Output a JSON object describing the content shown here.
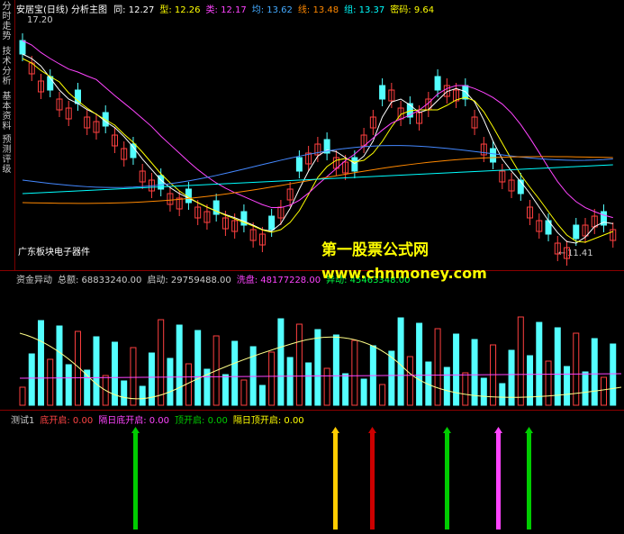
{
  "side_tabs": [
    {
      "id": "tab-timeshare",
      "label": "分时走势"
    },
    {
      "id": "tab-technical",
      "label": "技术分析"
    },
    {
      "id": "tab-fundamental",
      "label": "基本资料"
    },
    {
      "id": "tab-forecast",
      "label": "预测评级"
    }
  ],
  "header": {
    "title": "安居宝(日线) 分析主图",
    "items": [
      {
        "label": "同: 12.27",
        "color": "#ffffff"
      },
      {
        "label": "型: 12.26",
        "color": "#ffff00"
      },
      {
        "label": "类: 12.17",
        "color": "#ff44ff"
      },
      {
        "label": "均: 13.62",
        "color": "#44aaff"
      },
      {
        "label": "线: 13.48",
        "color": "#ff8800"
      },
      {
        "label": "组: 13.37",
        "color": "#00ffff"
      },
      {
        "label": "密码: 9.64",
        "color": "#ffff00"
      }
    ]
  },
  "price": {
    "high_label": "17.20",
    "low_label": "11.41",
    "sector": "广东板块",
    "industry": "电子器件"
  },
  "watermark": {
    "line1": "第一股票公式网",
    "line2": "www.chnmoney.com"
  },
  "fund_panel": {
    "items": [
      {
        "label": "资金异动",
        "color": "#cccccc"
      },
      {
        "label": "总额: 68833240.00",
        "color": "#cccccc"
      },
      {
        "label": "启动: 29759488.00",
        "color": "#cccccc"
      },
      {
        "label": "洗盘: 48177228.00",
        "color": "#ff44ff"
      },
      {
        "label": "异动: 45463348.00",
        "color": "#00ff44"
      }
    ]
  },
  "signal_panel": {
    "items": [
      {
        "label": "测试1",
        "color": "#cccccc"
      },
      {
        "label": "底开启: 0.00",
        "color": "#ff4444"
      },
      {
        "label": "隔日底开启: 0.00",
        "color": "#ff44ff"
      },
      {
        "label": "顶开启: 0.00",
        "color": "#00cc00"
      },
      {
        "label": "隔日顶开启: 0.00",
        "color": "#ffff00"
      }
    ]
  },
  "colors": {
    "up": "#ff4040",
    "down": "#54ffff",
    "ma5": "#ffffff",
    "ma10": "#ffff00",
    "ma20": "#ff44ff",
    "ma60": "#4488ff",
    "ma120": "#ff8800",
    "ma250": "#00ffff"
  }
}
